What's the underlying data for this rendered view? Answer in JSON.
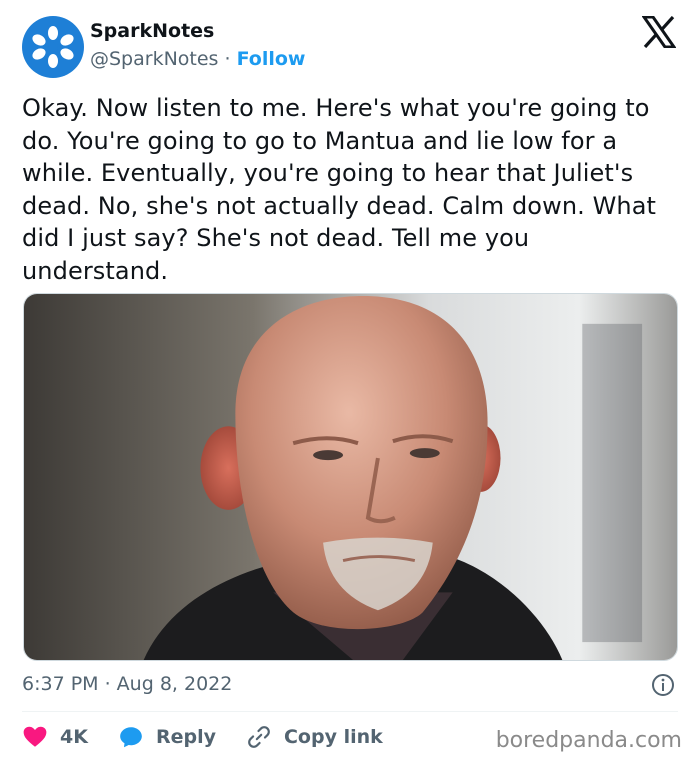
{
  "author": {
    "display_name": "SparkNotes",
    "handle": "@SparkNotes",
    "separator": " · ",
    "follow_label": "Follow",
    "avatar_icon": "sparknotes-logo-icon",
    "avatar_color": "#1e7fd6"
  },
  "platform_icon": "x-logo-icon",
  "tweet": {
    "text": "Okay. Now listen to me. Here's what you're going to do. You're going to go to Mantua and lie low for a while. Eventually, you're going to hear that Juliet's dead. No, she's not actually dead. Calm down. What did I just say? She's not dead. Tell me you understand."
  },
  "media": {
    "description_icon": "photo-bald-man-icon"
  },
  "meta": {
    "timestamp": "6:37 PM · Aug 8, 2022",
    "info_icon": "info-icon"
  },
  "actions": {
    "likes": {
      "icon": "heart-icon",
      "count": "4K",
      "color": "#f91880"
    },
    "reply": {
      "icon": "reply-bubble-icon",
      "label": "Reply",
      "color": "#1d9bf0"
    },
    "copy": {
      "icon": "link-icon",
      "label": "Copy link"
    }
  },
  "watermark": "boredpanda.com",
  "colors": {
    "accent": "#1d9bf0",
    "text_primary": "#0f1419",
    "text_secondary": "#536471"
  }
}
